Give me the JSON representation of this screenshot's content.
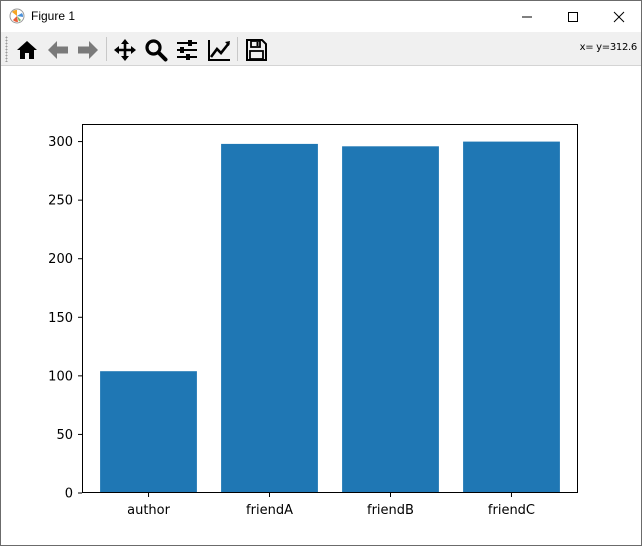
{
  "window": {
    "title": "Figure 1",
    "minimize_icon": "minimize-icon",
    "maximize_icon": "maximize-icon",
    "close_icon": "close-icon"
  },
  "toolbar": {
    "tools": [
      {
        "name": "home-icon"
      },
      {
        "name": "back-arrow-icon"
      },
      {
        "name": "forward-arrow-icon"
      },
      {
        "name": "pan-icon"
      },
      {
        "name": "zoom-icon"
      },
      {
        "name": "subplots-icon"
      },
      {
        "name": "edit-curve-icon"
      },
      {
        "name": "save-icon"
      }
    ],
    "coords": "x= y=312.6"
  },
  "colors": {
    "bar": "#1f77b4",
    "toolbar_bg": "#f0f0f0"
  },
  "chart_data": {
    "type": "bar",
    "categories": [
      "author",
      "friendA",
      "friendB",
      "friendC"
    ],
    "values": [
      104,
      298,
      296,
      300
    ],
    "ylim": [
      0,
      315
    ],
    "yticks": [
      0,
      50,
      100,
      150,
      200,
      250,
      300
    ],
    "grid": false,
    "title": "",
    "xlabel": "",
    "ylabel": ""
  }
}
